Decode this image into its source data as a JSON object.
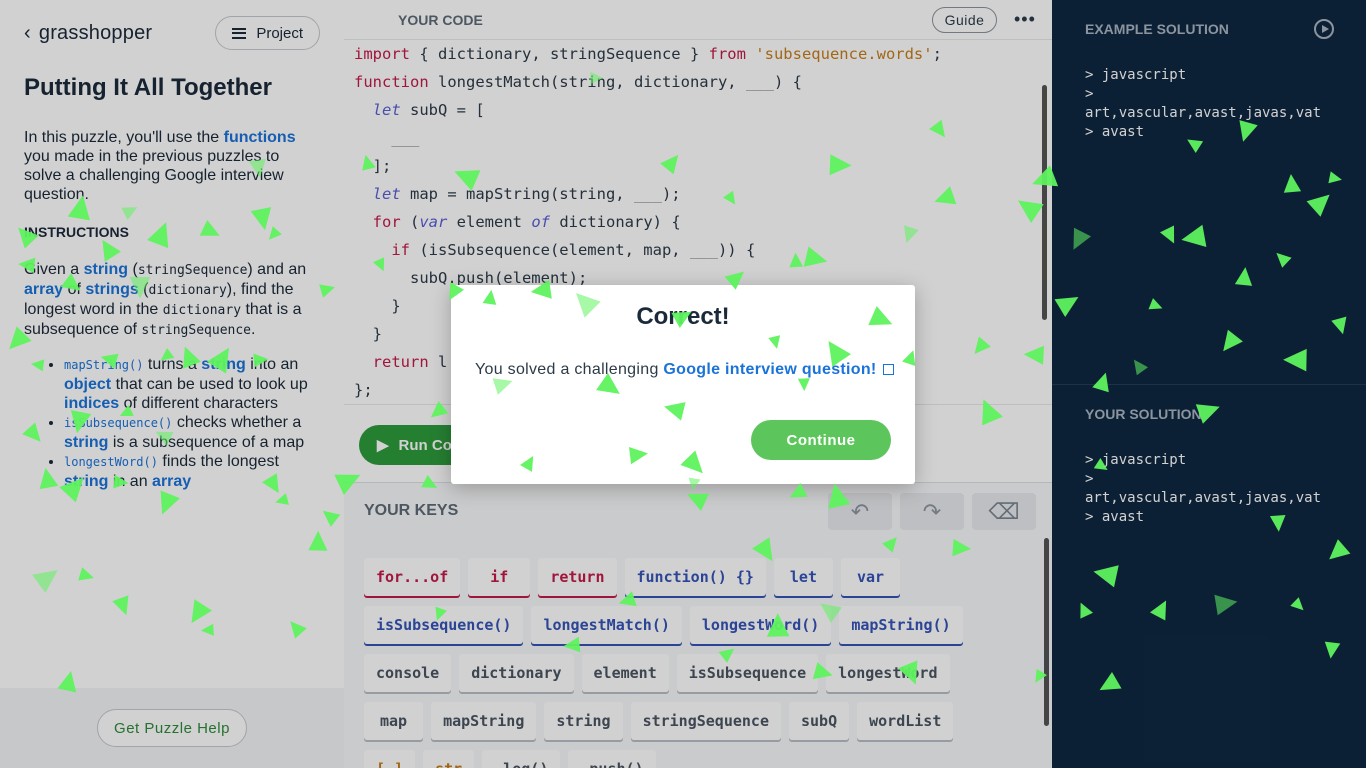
{
  "header": {
    "logo": "grasshopper",
    "project_button": "Project"
  },
  "lesson": {
    "title": "Putting It All Together",
    "intro": {
      "pre": "In this puzzle, you'll use the ",
      "link": "functions",
      "post": " you made in the previous puzzles to solve a challenging Google interview question."
    },
    "instructions_heading": "INSTRUCTIONS",
    "instructions": {
      "p1": "Given a ",
      "l1": "string",
      "c1": "stringSequence",
      "p2": ") and an ",
      "l2": "array",
      "p3": " of ",
      "l3": "strings",
      "c2": "dictionary",
      "p4": "), find the longest word in the ",
      "c3": "dictionary",
      "p5": " that is a subsequence of ",
      "c4": "stringSequence",
      "p6": "."
    },
    "bullets": [
      {
        "code": "mapString()",
        "t1": " turns a ",
        "l1": "string",
        "t2": " into an ",
        "l2": "object",
        "t3": " that can be used to look up ",
        "l3": "indices",
        "t4": " of different characters"
      },
      {
        "code": "isSubsequence()",
        "t1": " checks whether a ",
        "l1": "string",
        "t2": " is a subsequence of a map"
      },
      {
        "code": "longestWord()",
        "t1": " finds the longest ",
        "l1": "string",
        "t2": " in an ",
        "l2": "array"
      }
    ],
    "help_button": "Get Puzzle Help"
  },
  "editor": {
    "title": "YOUR CODE",
    "guide_button": "Guide",
    "more": "•••",
    "lines": {
      "l1": {
        "a": "import",
        "b": " { dictionary, stringSequence } ",
        "c": "from",
        "d": " ",
        "e": "'subsequence.words'",
        "f": ";"
      },
      "l2": {
        "a": "function",
        "b": " longestMatch(string, dictionary, ",
        "c": "___",
        "d": ") {"
      },
      "l3": {
        "a": "  ",
        "b": "let",
        "c": " subQ = ["
      },
      "l4": {
        "a": "    ",
        "b": "___"
      },
      "l5": {
        "a": "  ];"
      },
      "l6": {
        "a": "  ",
        "b": "let",
        "c": " map = mapString(string, ",
        "d": "___",
        "e": ");"
      },
      "l7": {
        "a": "  ",
        "b": "for",
        "c": " (",
        "d": "var",
        "e": " element ",
        "f": "of",
        "g": " dictionary) {"
      },
      "l8": {
        "a": "    ",
        "b": "if",
        "c": " (isSubsequence(element, map, ",
        "d": "___",
        "e": ")) {"
      },
      "l9": {
        "a": "      subQ.push(element);"
      },
      "l10": {
        "a": "    }"
      },
      "l11": {
        "a": "  }"
      },
      "l12": {
        "a": "  ",
        "b": "return",
        "c": " l"
      },
      "l13": {
        "a": "};"
      }
    },
    "run_button": "Run Co"
  },
  "keys": {
    "title": "YOUR KEYS",
    "row1": [
      "for...of",
      "if",
      "return",
      "function() {}",
      "let",
      "var"
    ],
    "row2": [
      "isSubsequence()",
      "longestMatch()",
      "longestWord()",
      "mapString()"
    ],
    "row3": [
      "console",
      "dictionary",
      "element",
      "isSubsequence",
      "longestWord"
    ],
    "row4": [
      "map",
      "mapString",
      "string",
      "stringSequence",
      "subQ",
      "wordList"
    ],
    "row5": [
      "[ ]",
      "str",
      ".log()",
      ".push()"
    ]
  },
  "example": {
    "title": "EXAMPLE SOLUTION",
    "output": "> javascript\n>\nart,vascular,avast,javas,vat\n> avast"
  },
  "yours": {
    "title": "YOUR SOLUTION",
    "output": "> javascript\n>\nart,vascular,avast,javas,vat\n> avast"
  },
  "modal": {
    "title": "Correct!",
    "text": "You solved a challenging ",
    "link": "Google interview question!",
    "continue_button": "Continue"
  },
  "colors": {
    "accent_green": "#5cc65c",
    "run_green": "#2e9b3c",
    "link_blue": "#1a73d9",
    "panel_dark": "#0f2841",
    "confetti": "#5ef25e"
  }
}
